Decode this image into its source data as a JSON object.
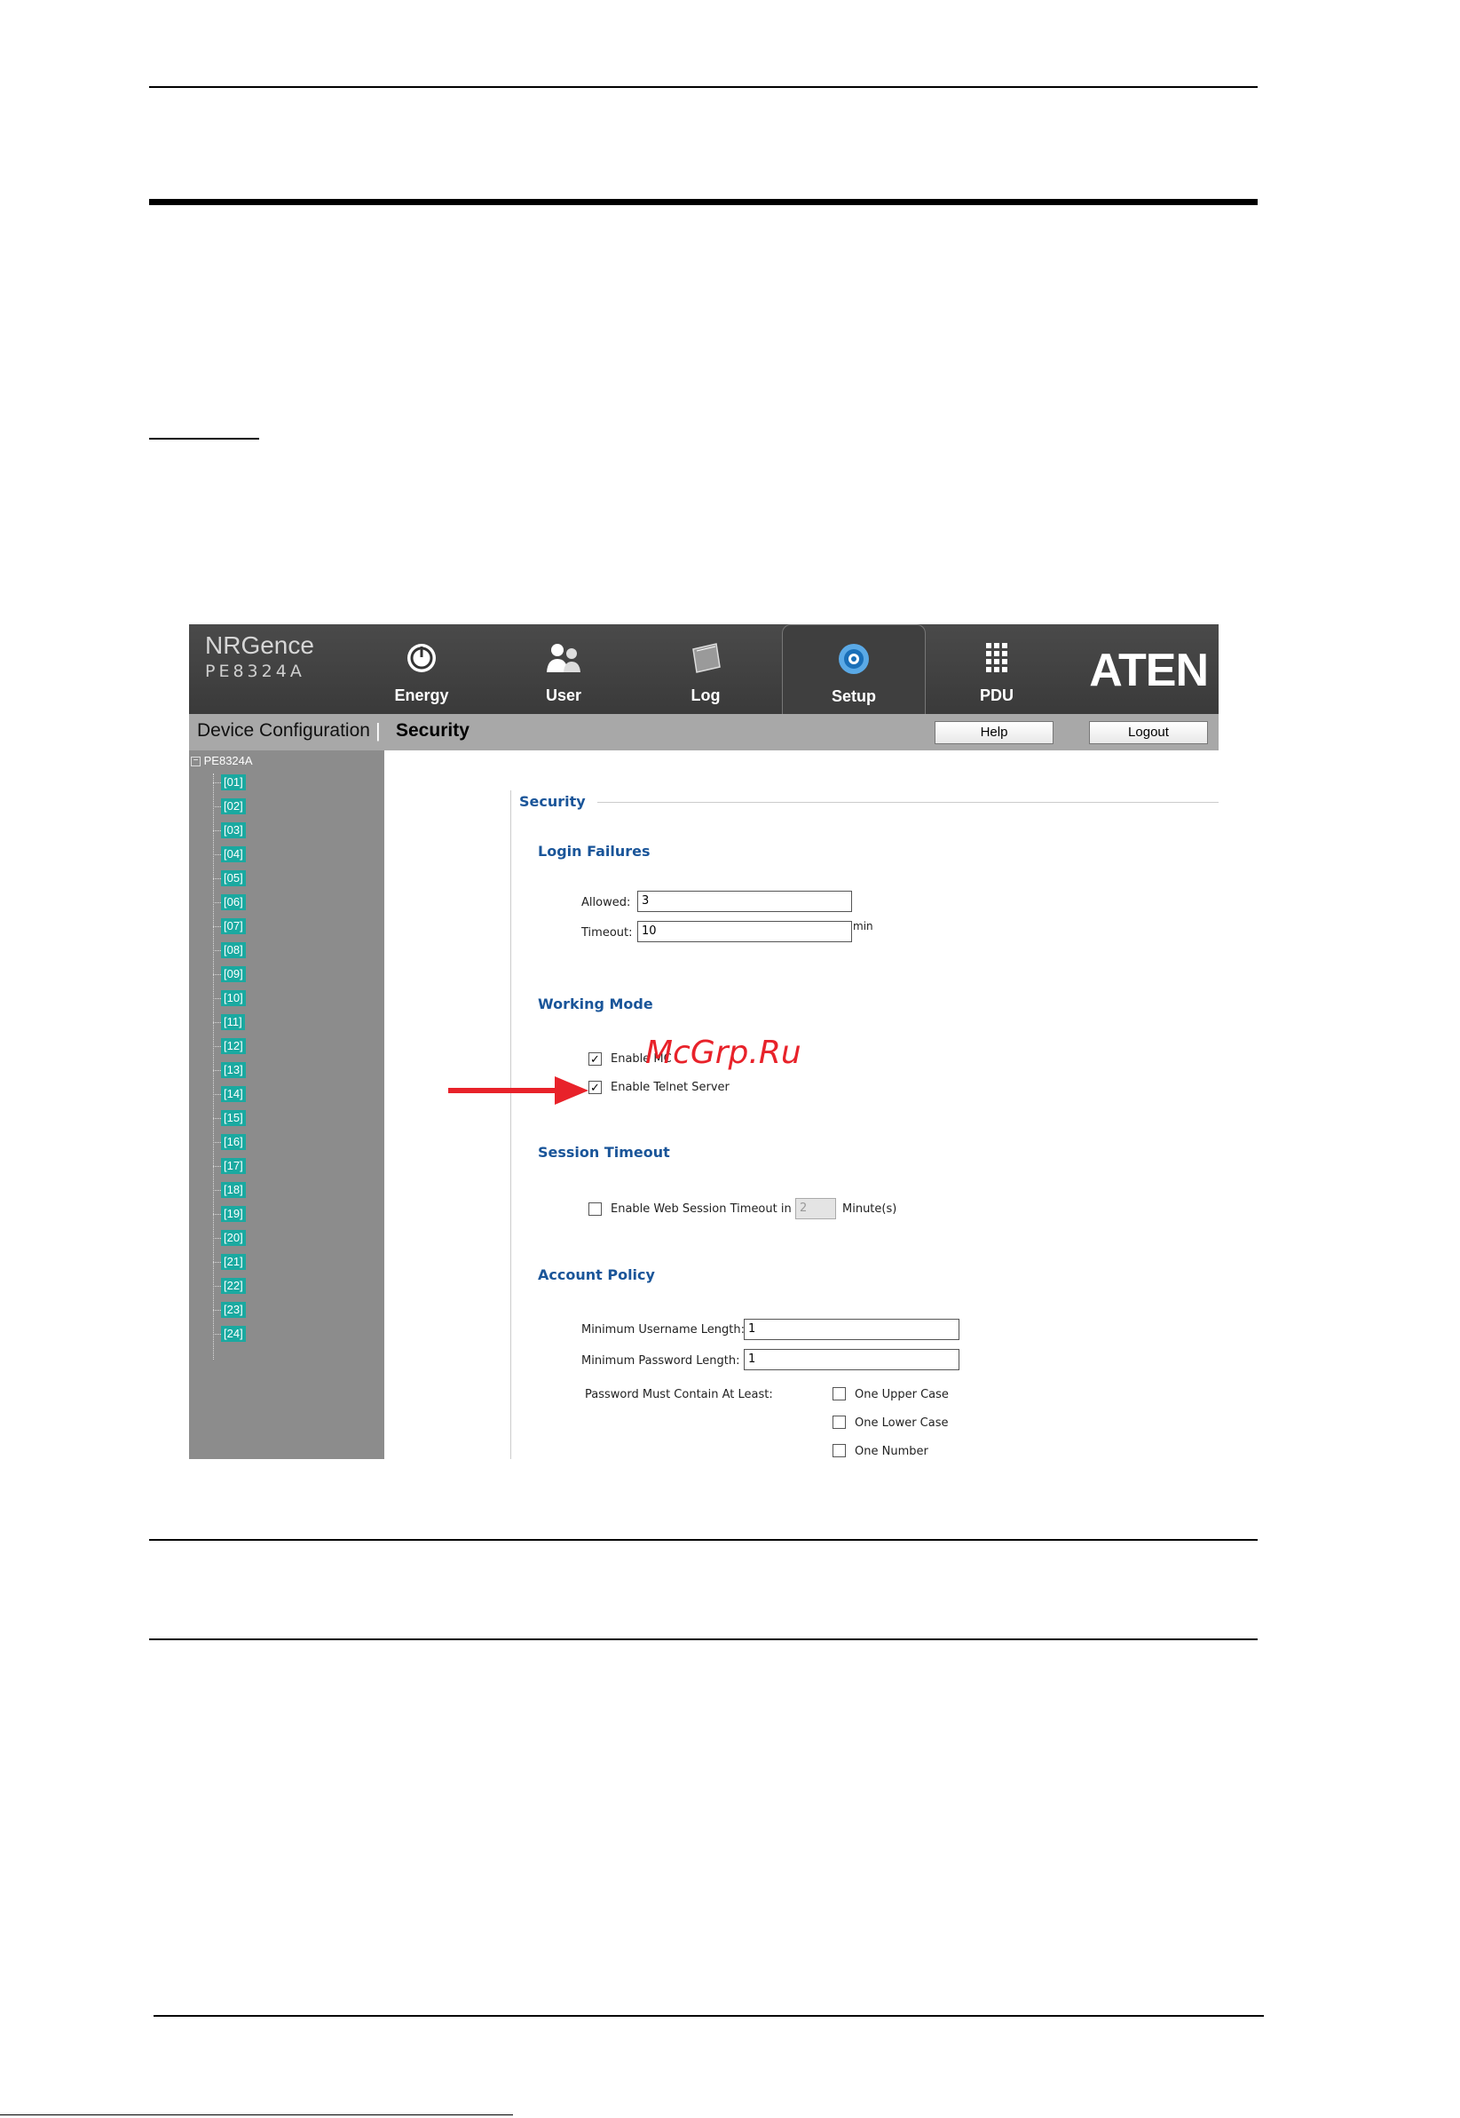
{
  "app": {
    "brand_name": "NRGence",
    "model": "PE8324A",
    "logo": "ATEN"
  },
  "nav": [
    {
      "label": "Energy",
      "icon": "power-icon"
    },
    {
      "label": "User",
      "icon": "users-icon"
    },
    {
      "label": "Log",
      "icon": "log-book-icon"
    },
    {
      "label": "Setup",
      "icon": "gear-icon",
      "active": true
    },
    {
      "label": "PDU",
      "icon": "outlet-grid-icon"
    }
  ],
  "breadcrumb": {
    "parent": "Device Configuration",
    "separator": "|",
    "current": "Security"
  },
  "toolbar": {
    "help_label": "Help",
    "logout_label": "Logout"
  },
  "tree": {
    "root": "PE8324A",
    "ports": [
      "[01]",
      "[02]",
      "[03]",
      "[04]",
      "[05]",
      "[06]",
      "[07]",
      "[08]",
      "[09]",
      "[10]",
      "[11]",
      "[12]",
      "[13]",
      "[14]",
      "[15]",
      "[16]",
      "[17]",
      "[18]",
      "[19]",
      "[20]",
      "[21]",
      "[22]",
      "[23]",
      "[24]"
    ]
  },
  "security": {
    "title": "Security",
    "login_failures": {
      "title": "Login Failures",
      "allowed_label": "Allowed:",
      "allowed_value": "3",
      "timeout_label": "Timeout:",
      "timeout_value": "10",
      "timeout_unit": "min"
    },
    "working_mode": {
      "title": "Working Mode",
      "option1_label": "Enable MC",
      "option1_checked": true,
      "option2_label": "Enable Telnet Server",
      "option2_checked": true
    },
    "session_timeout": {
      "title": "Session Timeout",
      "label": "Enable Web Session Timeout in",
      "value": "2",
      "unit": "Minute(s)",
      "checked": false
    },
    "account_policy": {
      "title": "Account Policy",
      "min_username_label": "Minimum Username Length:",
      "min_username_value": "1",
      "min_password_label": "Minimum Password Length:",
      "min_password_value": "1",
      "must_contain_label": "Password Must Contain At Least:",
      "options": [
        "One Upper Case",
        "One Lower Case",
        "One Number"
      ]
    }
  },
  "watermark": "McGrp.Ru",
  "colors": {
    "accent_blue": "#1a5599",
    "port_teal": "#1aa9a0",
    "arrow_red": "#e8222a"
  }
}
